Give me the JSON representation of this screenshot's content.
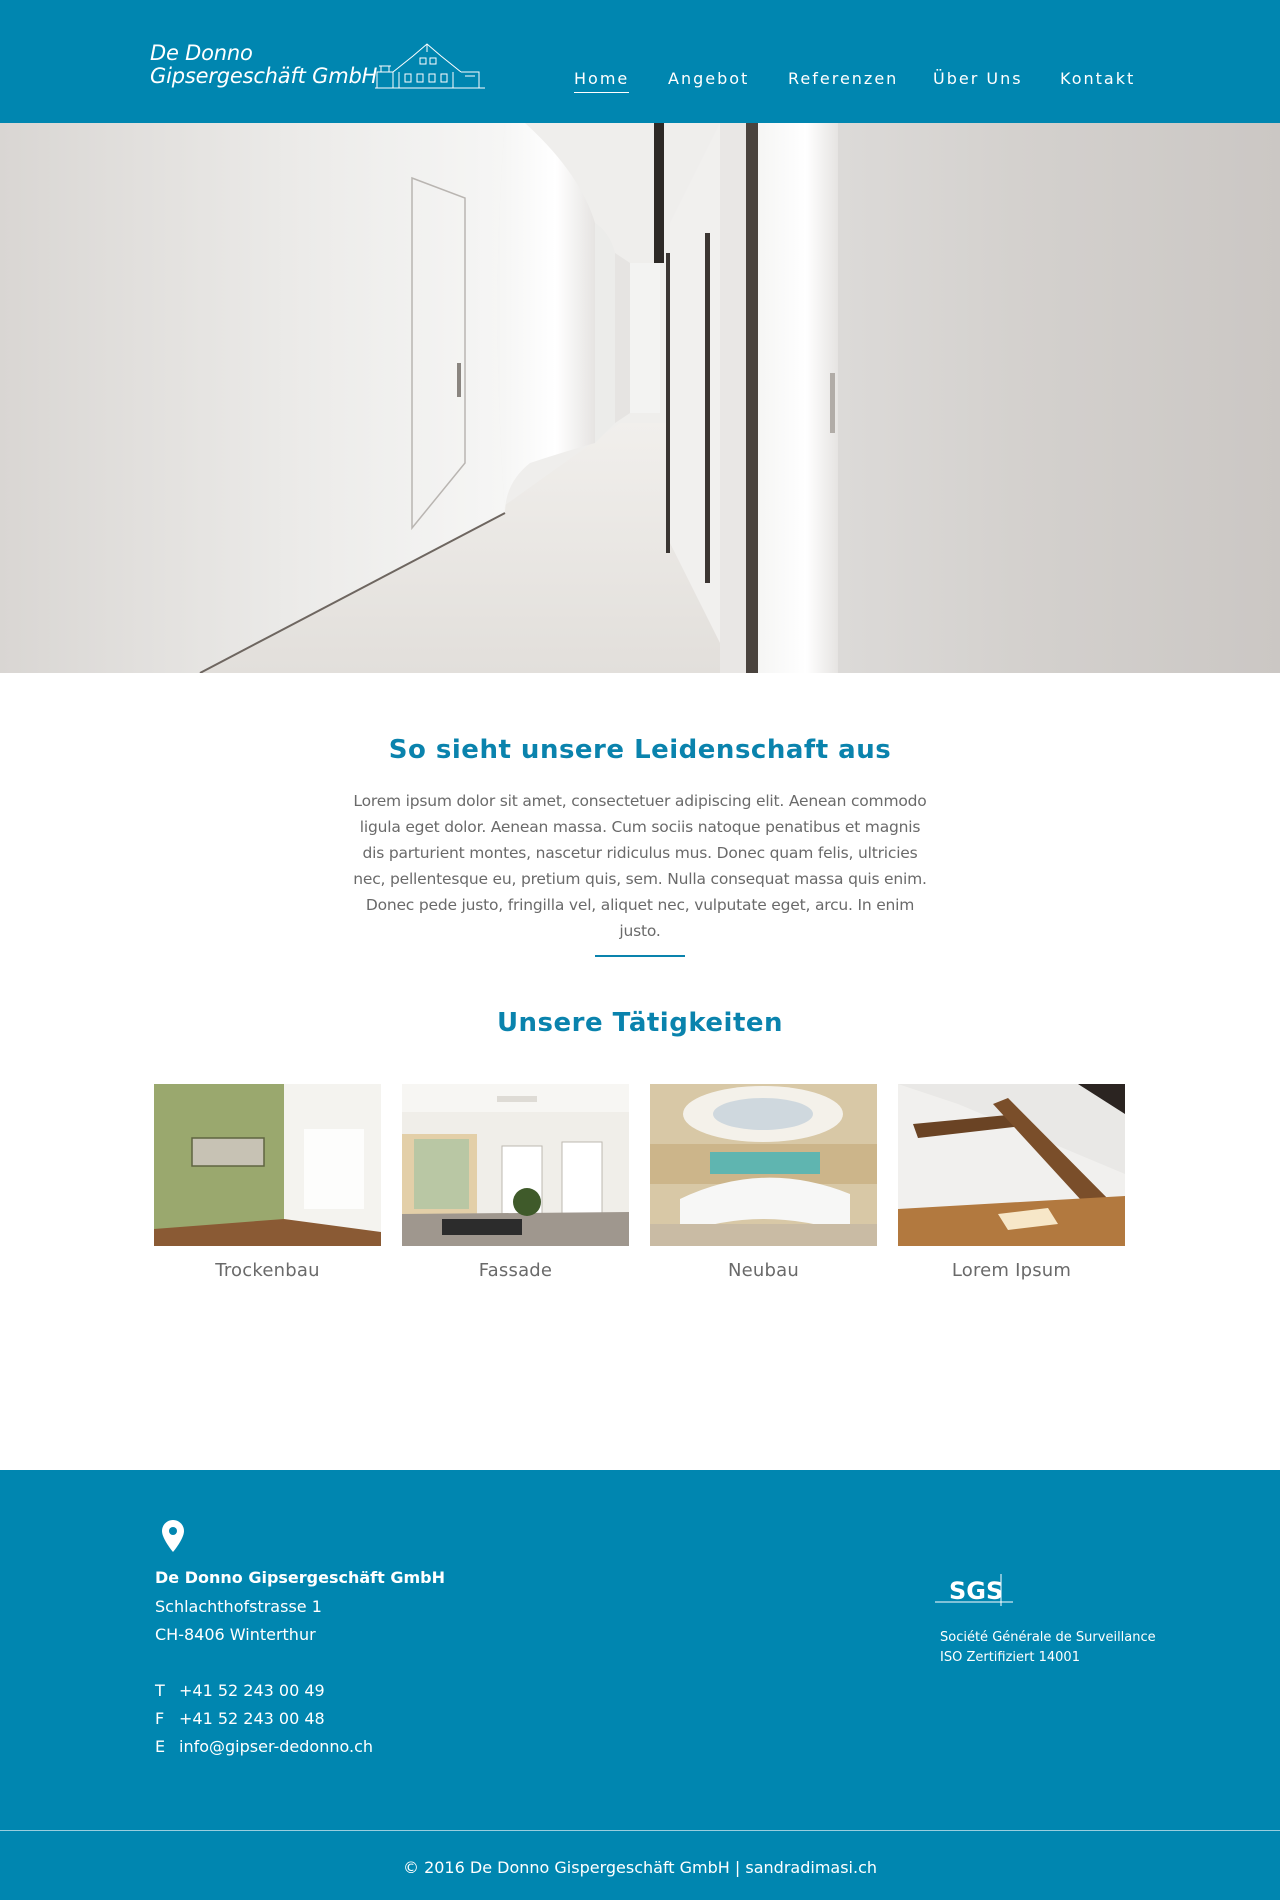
{
  "header": {
    "logo_line1": "De Donno",
    "logo_line2": "Gipsergeschäft GmbH",
    "nav": [
      {
        "label": "Home",
        "active": true
      },
      {
        "label": "Angebot",
        "active": false
      },
      {
        "label": "Referenzen",
        "active": false
      },
      {
        "label": "Über Uns",
        "active": false
      },
      {
        "label": "Kontakt",
        "active": false
      }
    ]
  },
  "intro": {
    "title": "So sieht unsere Leidenschaft aus",
    "text": "Lorem ipsum dolor sit amet, consectetuer adipiscing elit. Aenean commodo ligula eget dolor. Aenean massa. Cum sociis natoque penatibus et magnis dis parturient montes, nascetur ridiculus mus. Donec quam felis, ultricies nec, pellentesque eu, pretium quis, sem. Nulla consequat massa quis enim. Donec pede justo, fringilla vel, aliquet nec, vulputate eget, arcu. In enim justo."
  },
  "activities": {
    "title": "Unsere Tätigkeiten",
    "items": [
      {
        "label": "Trockenbau"
      },
      {
        "label": "Fassade"
      },
      {
        "label": "Neubau"
      },
      {
        "label": "Lorem Ipsum"
      }
    ]
  },
  "footer": {
    "company": "De Donno Gipsergeschäft GmbH",
    "street": "Schlachthofstrasse 1",
    "city": "CH-8406 Winterthur",
    "phone_key": "T",
    "phone": "+41 52 243 00 49",
    "fax_key": "F",
    "fax": "+41 52 243 00 48",
    "email_key": "E",
    "email": "info@gipser-dedonno.ch",
    "sgs_logo_text": "SGS",
    "sgs_line1": "Société Générale de Surveillance",
    "sgs_line2": "ISO Zertifiziert 14001",
    "copyright": "© 2016 De Donno Gispergeschäft GmbH | sandradimasi.ch"
  },
  "colors": {
    "brand": "#0086b0",
    "heading": "#0a83ad"
  }
}
